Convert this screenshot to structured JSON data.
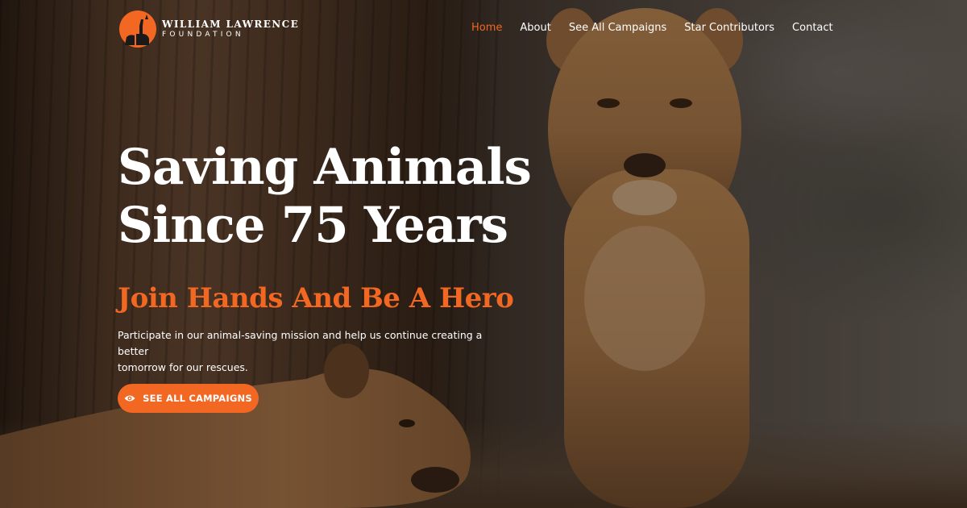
{
  "brand": {
    "name_line1": "WILLIAM LAWRENCE",
    "name_line2": "FOUNDATION",
    "accent_color": "#f26722",
    "logo_icon": "giraffe-elephant-sunset-logo"
  },
  "nav": {
    "items": [
      {
        "label": "Home",
        "active": true
      },
      {
        "label": "About",
        "active": false
      },
      {
        "label": "See All Campaigns",
        "active": false
      },
      {
        "label": "Star Contributors",
        "active": false
      },
      {
        "label": "Contact",
        "active": false
      }
    ]
  },
  "hero": {
    "title_line1": "Saving Animals",
    "title_line2": "Since 75 Years",
    "subtitle": "Join Hands And Be A Hero",
    "description_line1": "Participate in our animal-saving mission and help us continue creating a better",
    "description_line2": "tomorrow for our rescues.",
    "cta_label": "SEE ALL CAMPAIGNS",
    "cta_icon": "eye-icon",
    "background_image": "two lionesses in savanna beside tree trunk"
  }
}
